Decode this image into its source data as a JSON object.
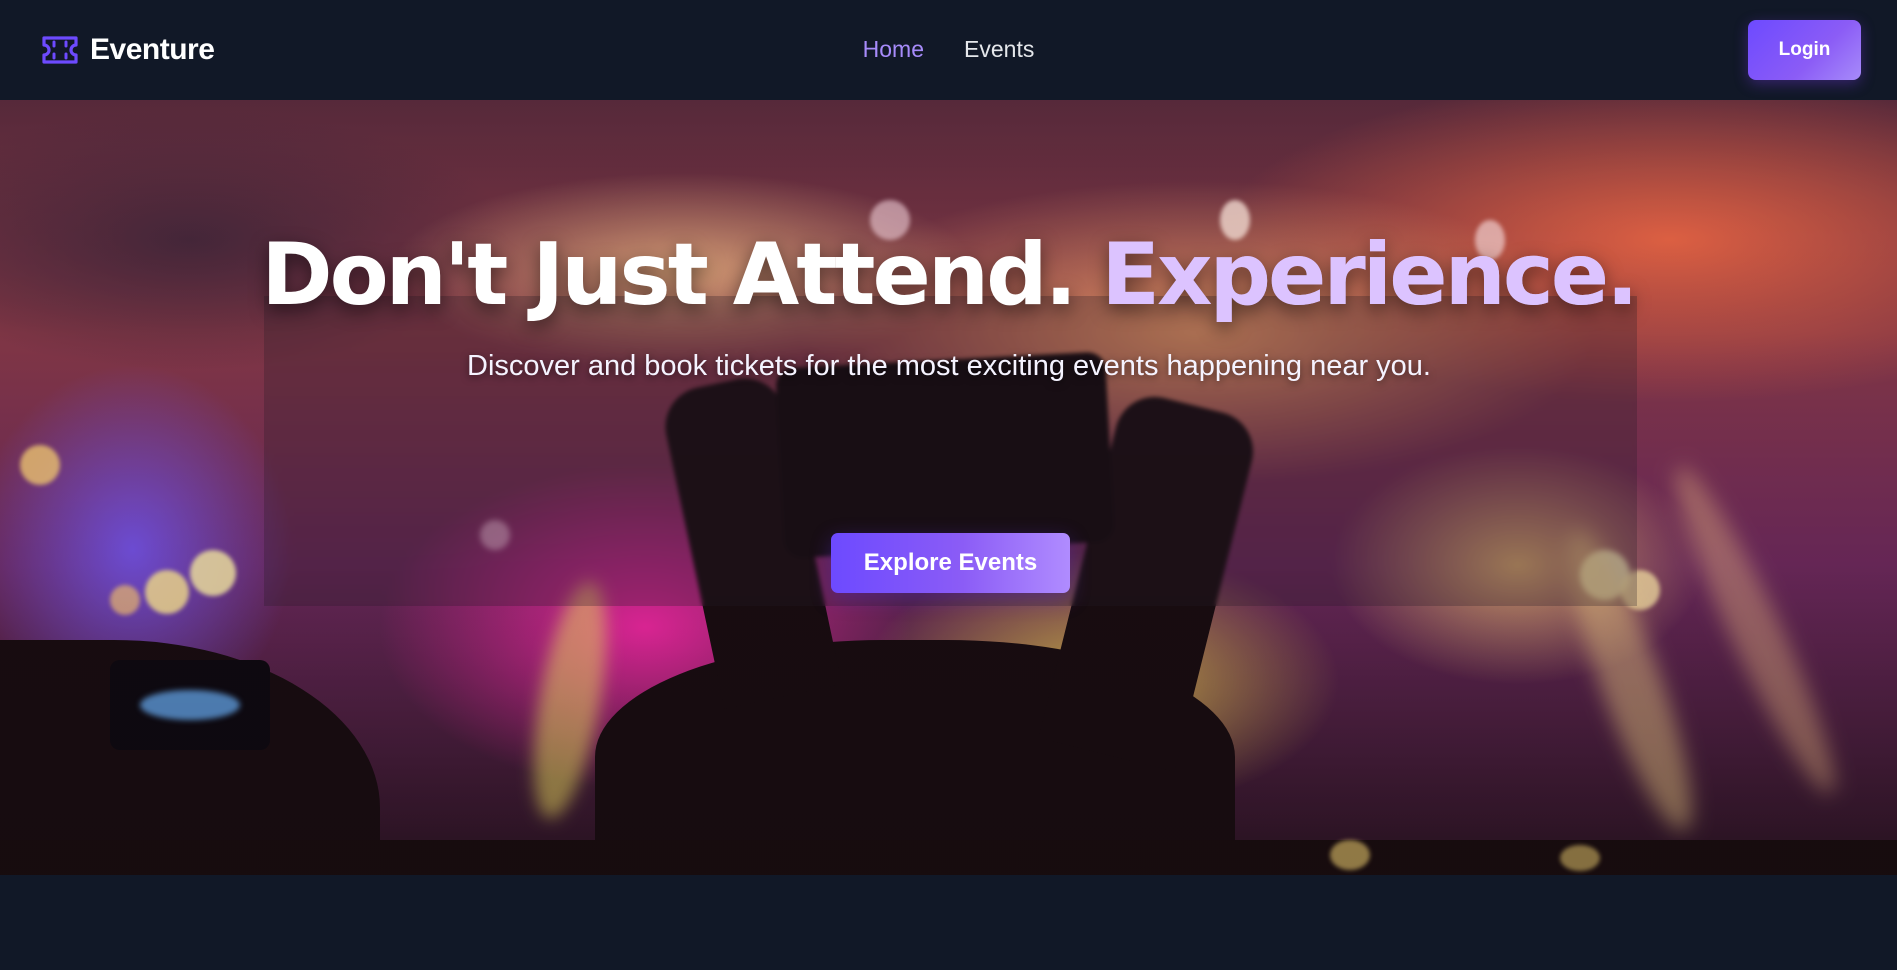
{
  "brand": {
    "name": "Eventure",
    "icon": "ticket-icon"
  },
  "nav": {
    "links": [
      {
        "label": "Home",
        "active": true
      },
      {
        "label": "Events",
        "active": false
      }
    ],
    "login_label": "Login"
  },
  "hero": {
    "headline_main": "Don't Just Attend.",
    "headline_accent": "Experience.",
    "subheadline": "Discover and book tickets for the most exciting events happening near you.",
    "cta_label": "Explore Events"
  },
  "colors": {
    "background": "#111827",
    "accent": "#8b5cf6",
    "nav_active": "#a78bfa",
    "headline_accent": "#dcc3ff"
  }
}
